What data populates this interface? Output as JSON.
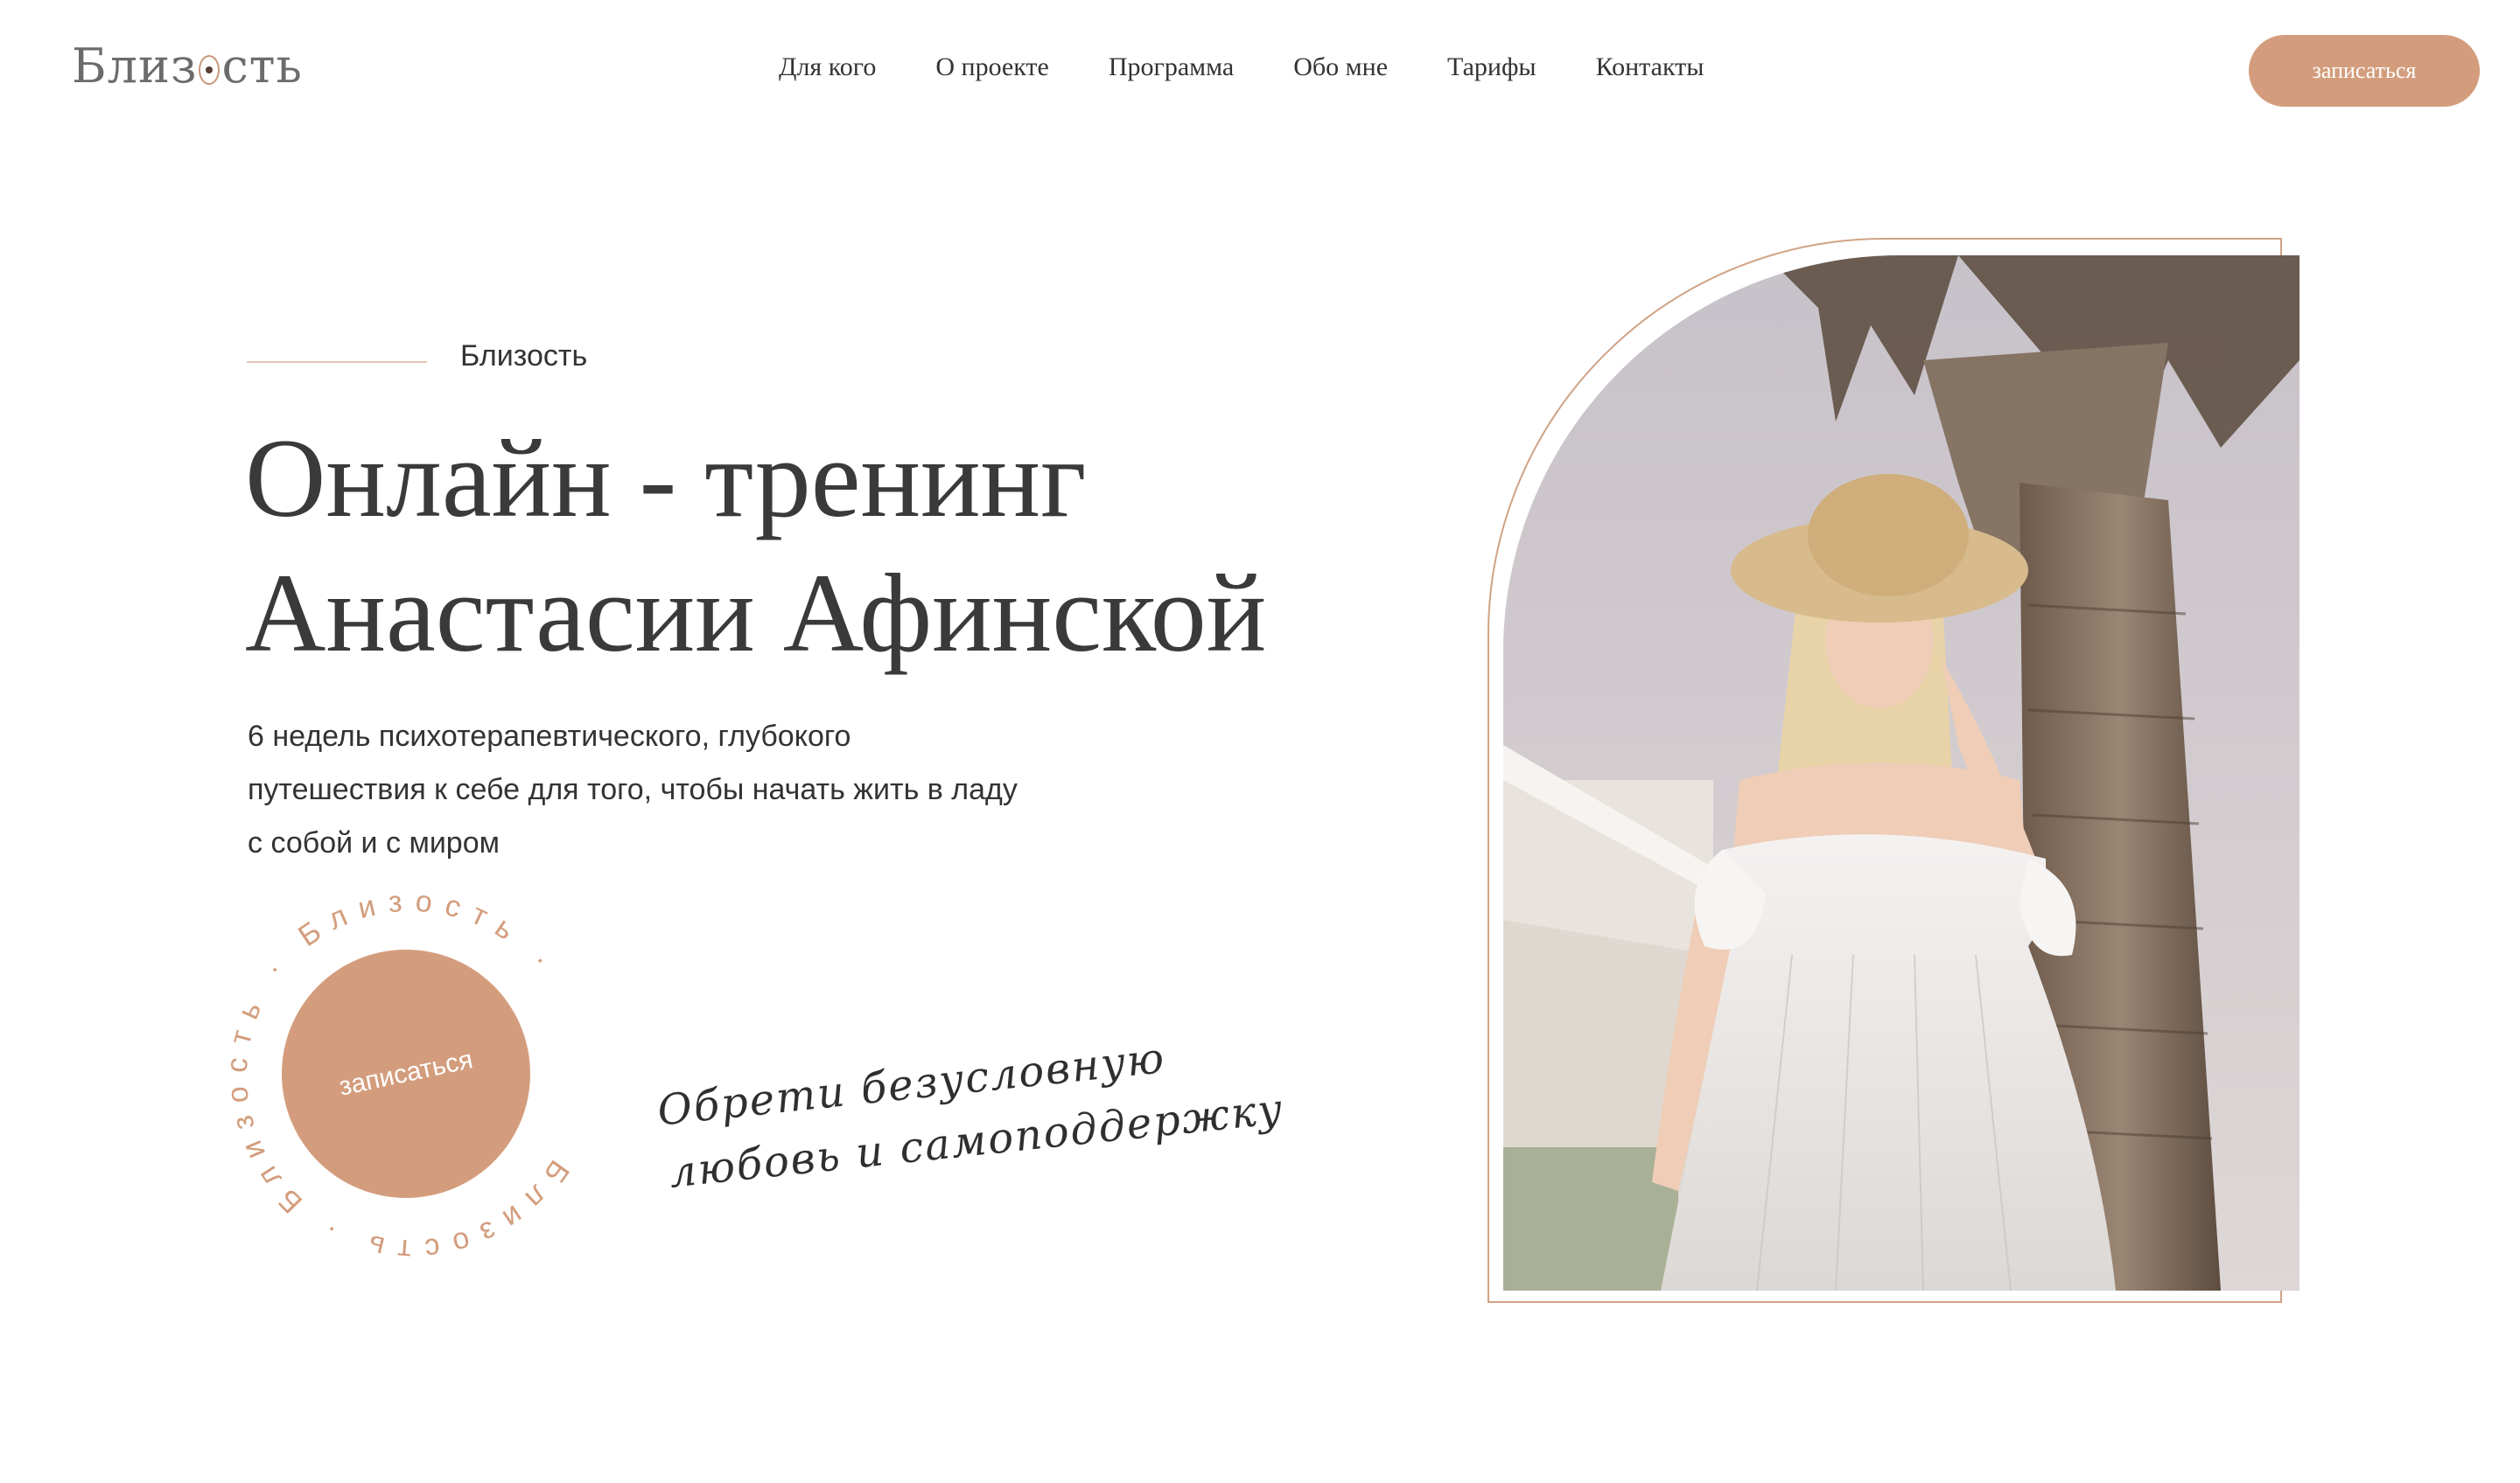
{
  "header": {
    "logo_before": "Близ",
    "logo_after": "сть",
    "nav": [
      "Для кого",
      "О проекте",
      "Программа",
      "Обо мне",
      "Тарифы",
      "Контакты"
    ],
    "cta_label": "записаться"
  },
  "hero": {
    "eyebrow": "Близость",
    "title_line1": "Онлайн - тренинг",
    "title_line2": "Анастасии Афинской",
    "lead_line1": "6 недель психотерапевтического, глубокого",
    "lead_line2": "путешествия к себе для того, чтобы начать жить в ладу",
    "lead_line3": "с собой и с миром",
    "circle_cta_label": "записаться",
    "circle_ring_text": "Близость · Близость · Близость ·",
    "script_line1": "Обрети безусловную",
    "script_line2": "любовь и самоподдержку"
  },
  "colors": {
    "accent": "#d39d7d",
    "frame": "#d0a385",
    "text": "#3a3a3a"
  },
  "photo": {
    "subject": "woman-in-white-dress-and-straw-hat-by-palm-tree"
  }
}
